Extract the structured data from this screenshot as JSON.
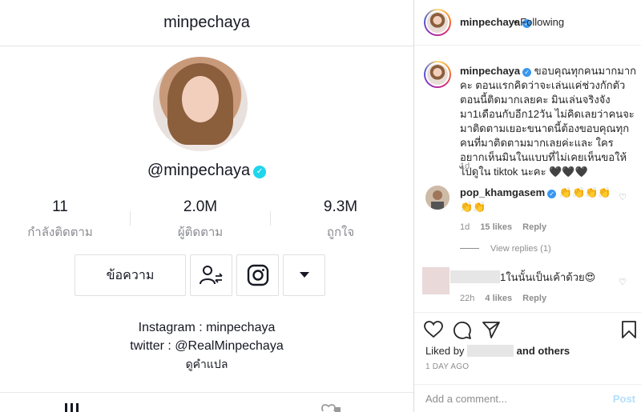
{
  "tiktok": {
    "header_title": "minpechaya",
    "handle": "@minpechaya",
    "stats": [
      {
        "num": "11",
        "label": "กำลังติดตาม"
      },
      {
        "num": "2.0M",
        "label": "ผู้ติดตาม"
      },
      {
        "num": "9.3M",
        "label": "ถูกใจ"
      }
    ],
    "message_button": "ข้อความ",
    "bio_line1": "Instagram : minpechaya",
    "bio_line2": "twitter : @RealMinpechaya",
    "translate": "ดูคำแปล"
  },
  "instagram": {
    "post_user": "minpechaya",
    "following": "• Following",
    "caption_user": "minpechaya",
    "caption_text": "ขอบคุณทุกคนมากมากคะ ตอนแรกคิดว่าจะเล่นแค่ช่วงกักตัว ตอนนี้ติดมากเลยคะ มินเล่นจริงจังมา1เดือนกับอีก12วัน ไม่คิดเลยว่าคนจะมาติดตามเยอะขนาดนี้ต้องขอบคุณทุกคนที่มาติดตามมากเลยค่ะและ ใครอยากเห็นมินในแบบที่ไม่เคยเห็นขอให้ไปดูใน tiktok นะคะ 🖤🖤🖤",
    "caption_time": "1d",
    "comment1": {
      "user": "pop_khamgasem",
      "text": "👏👏👏👏👏👏",
      "time": "1d",
      "likes": "15 likes",
      "reply": "Reply"
    },
    "view_replies": "View replies (1)",
    "comment2": {
      "text": "1ในนั้นเป็นเค้าด้วย😍",
      "time": "22h",
      "likes": "4 likes",
      "reply": "Reply"
    },
    "liked_by_prefix": "Liked by",
    "liked_by_suffix": "and others",
    "date": "1 DAY AGO",
    "add_comment_placeholder": "Add a comment...",
    "post_button": "Post"
  }
}
